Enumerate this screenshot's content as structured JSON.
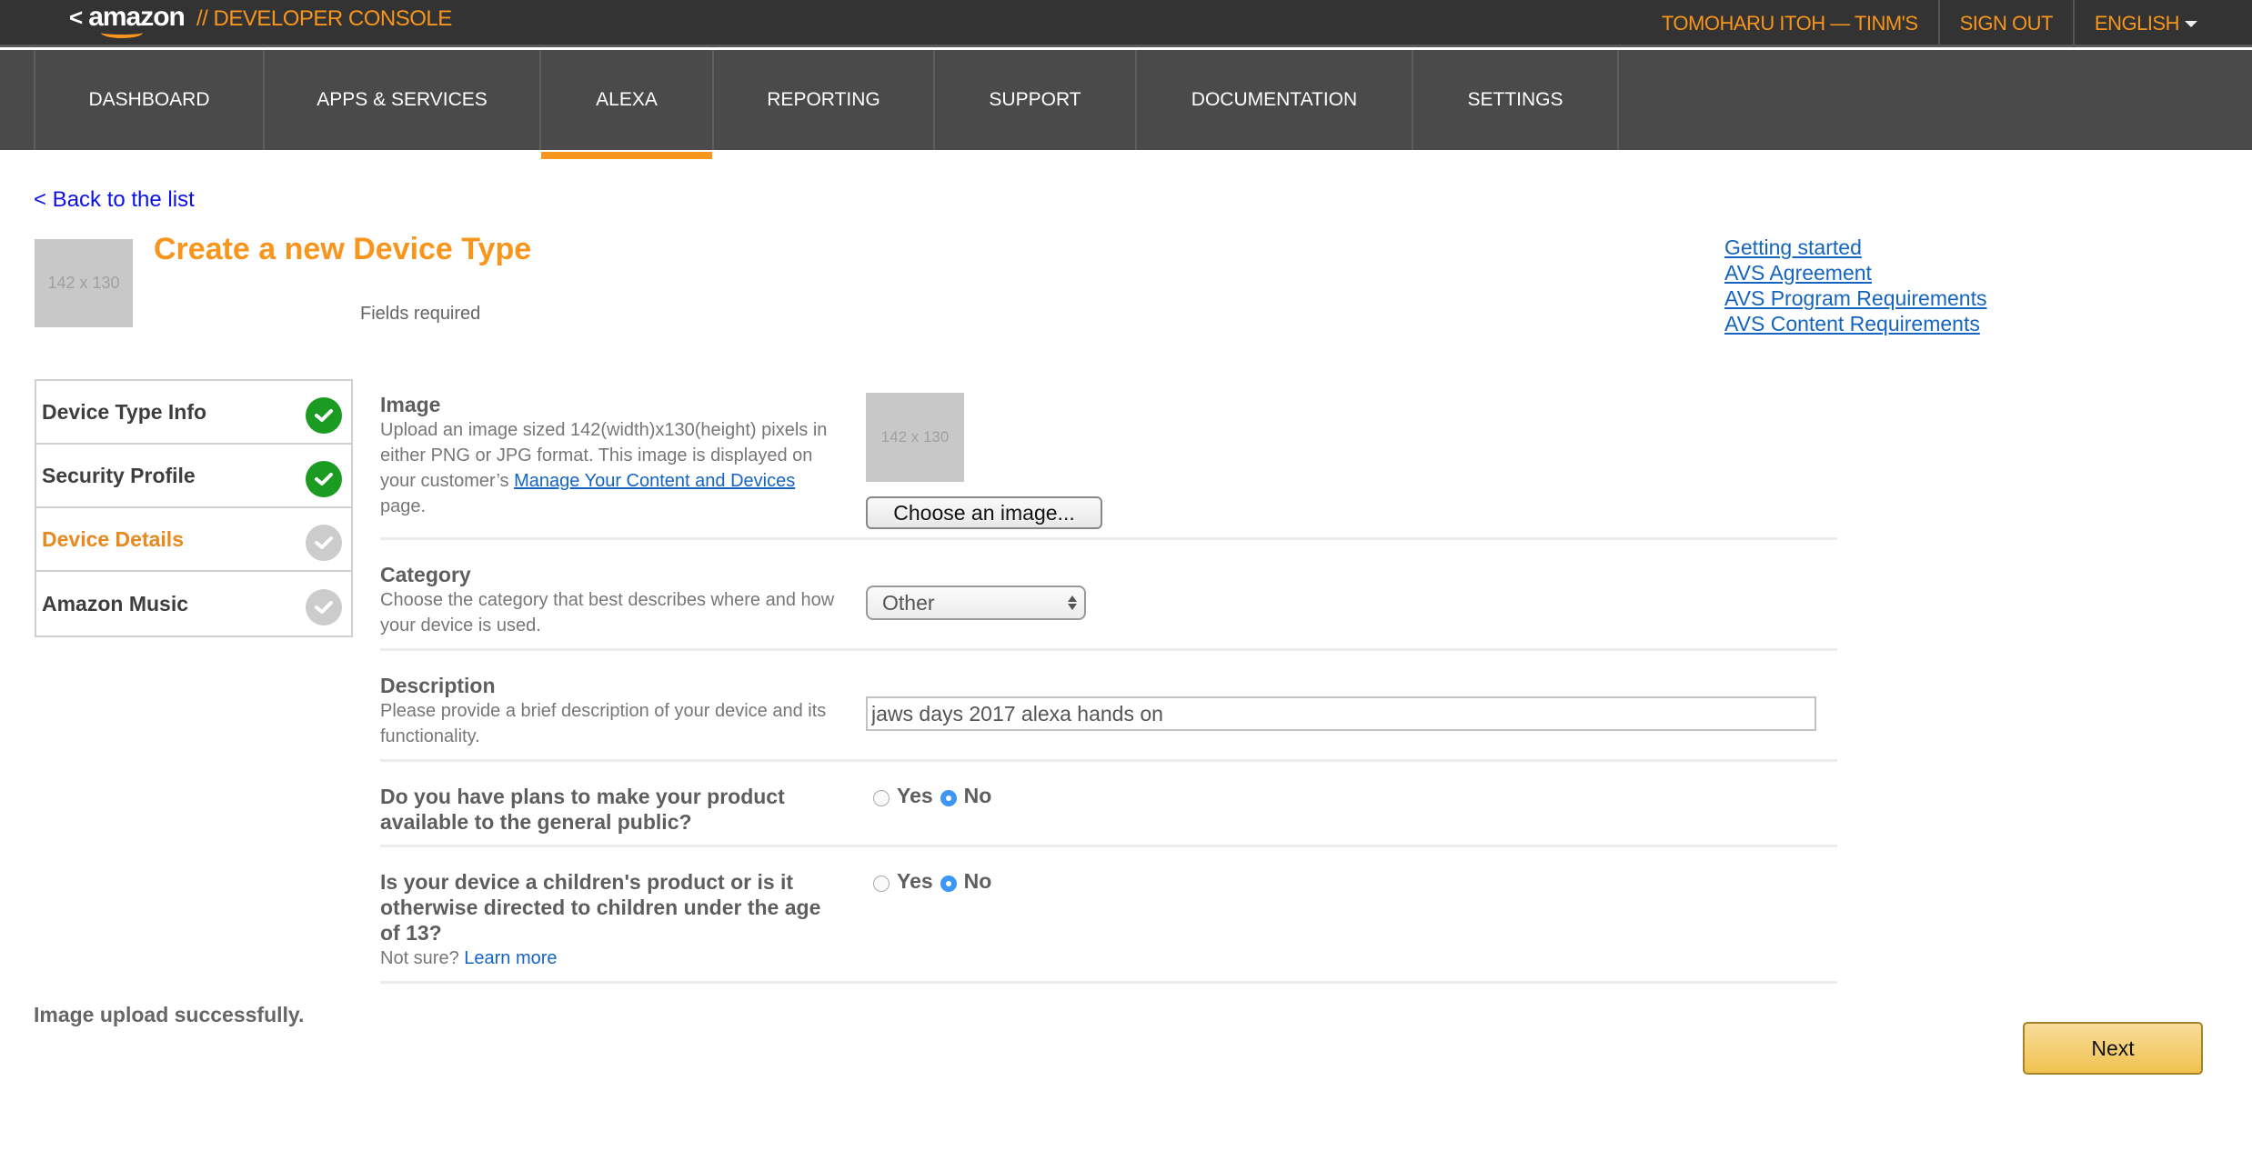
{
  "header": {
    "logo_back": "<",
    "logo_text": "amazon",
    "console_label": "// DEVELOPER CONSOLE",
    "user": "TOMOHARU ITOH — TINM'S",
    "sign_out": "SIGN OUT",
    "language": "ENGLISH"
  },
  "nav": {
    "items": [
      {
        "label": "DASHBOARD",
        "active": false
      },
      {
        "label": "APPS & SERVICES",
        "active": false
      },
      {
        "label": "ALEXA",
        "active": true
      },
      {
        "label": "REPORTING",
        "active": false
      },
      {
        "label": "SUPPORT",
        "active": false
      },
      {
        "label": "DOCUMENTATION",
        "active": false
      },
      {
        "label": "SETTINGS",
        "active": false
      }
    ],
    "active_color": "#f7951d"
  },
  "page": {
    "back_link": "< Back to the list",
    "header_image_placeholder": "142 x 130",
    "title": "Create a new Device Type",
    "fields_required": "Fields required"
  },
  "right_links": [
    "Getting started",
    "AVS Agreement",
    "AVS Program Requirements",
    "AVS Content Requirements"
  ],
  "steps": [
    {
      "label": "Device Type Info",
      "status": "done"
    },
    {
      "label": "Security Profile",
      "status": "done"
    },
    {
      "label": "Device Details",
      "status": "current"
    },
    {
      "label": "Amazon Music",
      "status": "pending"
    }
  ],
  "form": {
    "image": {
      "title": "Image",
      "desc_before": "Upload an image sized 142(width)x130(height) pixels in either PNG or JPG format. This image is displayed on your customer’s ",
      "desc_link": "Manage Your Content and Devices",
      "desc_after": " page.",
      "preview_placeholder": "142 x 130",
      "choose_button": "Choose an image..."
    },
    "category": {
      "title": "Category",
      "desc": "Choose the category that best describes where and how your device is used.",
      "selected": "Other"
    },
    "description": {
      "title": "Description",
      "desc": "Please provide a brief description of your device and its functionality.",
      "value": "jaws days 2017 alexa hands on"
    },
    "public": {
      "title": "Do you have plans to make your product available to the general public?",
      "yes_label": "Yes",
      "no_label": "No",
      "selected": "No"
    },
    "children": {
      "title": "Is your device a children's product or is it otherwise directed to children under the age of 13?",
      "not_sure": "Not sure?",
      "learn_more": "Learn more",
      "yes_label": "Yes",
      "no_label": "No",
      "selected": "No"
    }
  },
  "status_message": "Image upload successfully.",
  "next_button": "Next"
}
